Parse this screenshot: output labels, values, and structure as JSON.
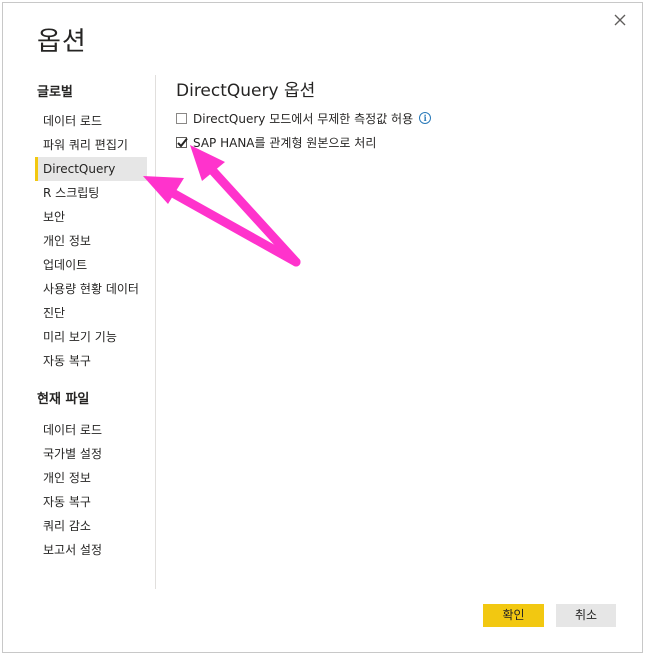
{
  "dialog": {
    "title": "옵션",
    "close_icon": "close-icon"
  },
  "sidebar": {
    "global_heading": "글로벌",
    "global_items": [
      {
        "label": "데이터 로드"
      },
      {
        "label": "파워 쿼리 편집기"
      },
      {
        "label": "DirectQuery",
        "selected": true
      },
      {
        "label": "R 스크립팅"
      },
      {
        "label": "보안"
      },
      {
        "label": "개인 정보"
      },
      {
        "label": "업데이트"
      },
      {
        "label": "사용량 현황 데이터"
      },
      {
        "label": "진단"
      },
      {
        "label": "미리 보기 기능"
      },
      {
        "label": "자동 복구"
      }
    ],
    "current_file_heading": "현재 파일",
    "current_file_items": [
      {
        "label": "데이터 로드"
      },
      {
        "label": "국가별 설정"
      },
      {
        "label": "개인 정보"
      },
      {
        "label": "자동 복구"
      },
      {
        "label": "쿼리 감소"
      },
      {
        "label": "보고서 설정"
      }
    ]
  },
  "content": {
    "title": "DirectQuery 옵션",
    "options": [
      {
        "label": "DirectQuery 모드에서 무제한 측정값 허용",
        "checked": false,
        "info_icon": "info-icon"
      },
      {
        "label": "SAP HANA를 관계형 원본으로 처리",
        "checked": true
      }
    ]
  },
  "footer": {
    "ok_label": "확인",
    "cancel_label": "취소"
  },
  "colors": {
    "accent": "#f2c811",
    "annotation_arrow": "#ff33cc",
    "selected_bg": "#e6e6e6"
  }
}
